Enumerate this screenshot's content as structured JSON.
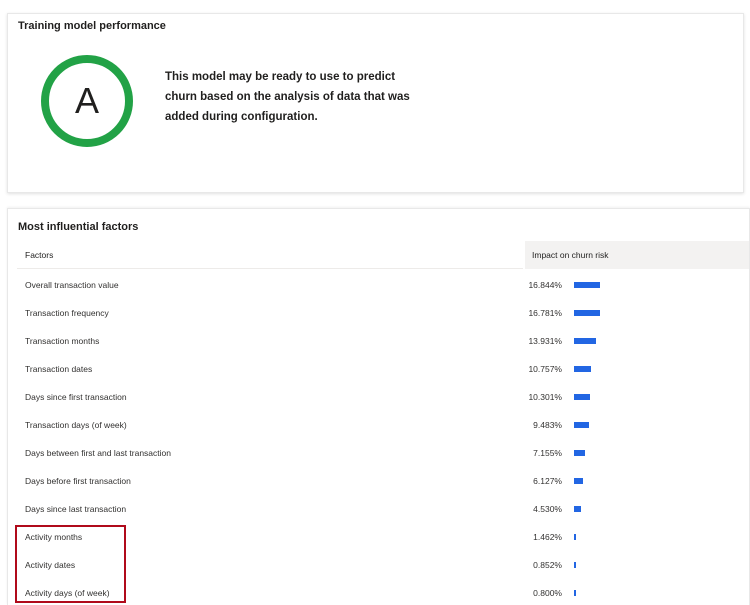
{
  "performance": {
    "title": "Training model performance",
    "grade": "A",
    "grade_color": "#22a246",
    "description": "This model may be ready to use to predict churn based on the analysis of data that was added during configuration."
  },
  "factors": {
    "title": "Most influential factors",
    "columns": {
      "factor": "Factors",
      "impact": "Impact on churn risk"
    },
    "bar_color": "#2266e3",
    "max_value": 16.844,
    "rows": [
      {
        "name": "Overall transaction value",
        "value_text": "16.844%",
        "value": 16.844
      },
      {
        "name": "Transaction frequency",
        "value_text": "16.781%",
        "value": 16.781
      },
      {
        "name": "Transaction months",
        "value_text": "13.931%",
        "value": 13.931
      },
      {
        "name": "Transaction dates",
        "value_text": "10.757%",
        "value": 10.757
      },
      {
        "name": "Days since first transaction",
        "value_text": "10.301%",
        "value": 10.301
      },
      {
        "name": "Transaction days (of week)",
        "value_text": "9.483%",
        "value": 9.483
      },
      {
        "name": "Days between first and last transaction",
        "value_text": "7.155%",
        "value": 7.155
      },
      {
        "name": "Days before first transaction",
        "value_text": "6.127%",
        "value": 6.127
      },
      {
        "name": "Days since last transaction",
        "value_text": "4.530%",
        "value": 4.53
      },
      {
        "name": "Activity months",
        "value_text": "1.462%",
        "value": 1.462
      },
      {
        "name": "Activity dates",
        "value_text": "0.852%",
        "value": 0.852
      },
      {
        "name": "Activity days (of week)",
        "value_text": "0.800%",
        "value": 0.8
      }
    ]
  },
  "annotation": {
    "highlight_color": "#b00a1b"
  }
}
